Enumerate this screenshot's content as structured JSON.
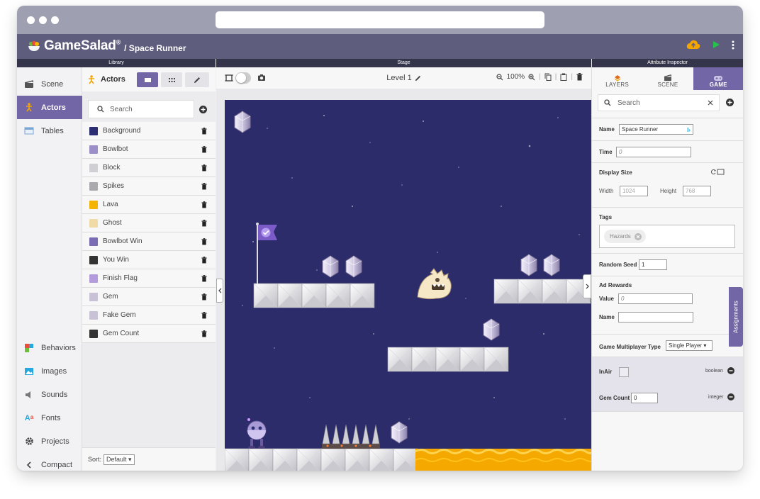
{
  "app": {
    "name": "GameSalad",
    "trademark": "®",
    "project": "/ Space Runner"
  },
  "section_titles": {
    "library": "Library",
    "stage": "Stage",
    "inspector": "Attribute Inspector"
  },
  "sidenav": {
    "top": [
      {
        "name": "scene",
        "label": "Scene",
        "icon": "scene-icon"
      },
      {
        "name": "actors",
        "label": "Actors",
        "icon": "actor-icon",
        "active": true
      },
      {
        "name": "tables",
        "label": "Tables",
        "icon": "table-icon"
      }
    ],
    "bottom": [
      {
        "name": "behaviors",
        "label": "Behaviors",
        "icon": "behaviors-icon"
      },
      {
        "name": "images",
        "label": "Images",
        "icon": "image-icon"
      },
      {
        "name": "sounds",
        "label": "Sounds",
        "icon": "sound-icon"
      },
      {
        "name": "fonts",
        "label": "Fonts",
        "icon": "fonts-icon"
      },
      {
        "name": "projects",
        "label": "Projects",
        "icon": "gear-icon"
      },
      {
        "name": "compact",
        "label": "Compact",
        "icon": "chevron-left-icon"
      }
    ]
  },
  "library": {
    "title": "Actors",
    "search_placeholder": "Search",
    "actors": [
      {
        "label": "Background",
        "color": "#2b2e72"
      },
      {
        "label": "Bowlbot",
        "color": "#9c8ec8"
      },
      {
        "label": "Block",
        "color": "#cfcfd4"
      },
      {
        "label": "Spikes",
        "color": "#a9a9ae"
      },
      {
        "label": "Lava",
        "color": "#f5b400"
      },
      {
        "label": "Ghost",
        "color": "#f0dba6"
      },
      {
        "label": "Bowlbot Win",
        "color": "#7a6bb4"
      },
      {
        "label": "You Win",
        "color": "#333333"
      },
      {
        "label": "Finish Flag",
        "color": "#b49bdc"
      },
      {
        "label": "Gem",
        "color": "#c9c2d6"
      },
      {
        "label": "Fake Gem",
        "color": "#c9c2d6"
      },
      {
        "label": "Gem Count",
        "color": "#333333"
      }
    ],
    "sort_label": "Sort:",
    "sort_value": "Default"
  },
  "stage": {
    "level": "Level 1",
    "zoom": "100%"
  },
  "inspector": {
    "tabs": [
      {
        "label": "LAYERS",
        "icon": "layers-icon"
      },
      {
        "label": "SCENE",
        "icon": "scene-icon"
      },
      {
        "label": "GAME",
        "icon": "gamepad-icon",
        "active": true
      }
    ],
    "search_placeholder": "Search",
    "name_label": "Name",
    "name_value": "Space Runner",
    "time_label": "Time",
    "time_placeholder": "0",
    "display_size_label": "Display Size",
    "width_label": "Width",
    "width_placeholder": "1024",
    "height_label": "Height",
    "height_placeholder": "768",
    "tags_label": "Tags",
    "tag": "Hazards",
    "random_seed_label": "Random Seed",
    "random_seed_value": "1",
    "ad_rewards_label": "Ad Rewards",
    "value_label": "Value",
    "value_placeholder": "0",
    "ad_name_label": "Name",
    "multiplayer_label": "Game Multiplayer Type",
    "multiplayer_value": "Single Player",
    "inair_label": "InAir",
    "inair_type": "boolean",
    "gemcount_label": "Gem Count",
    "gemcount_value": "0",
    "gemcount_type": "integer",
    "assignments_label": "Assignments"
  },
  "colors": {
    "accent": "#7366a6",
    "appbar": "#5e5d7e",
    "chrome": "#9e9fb0",
    "space": "#2d2c6a",
    "lava": "#f5a800",
    "upload": "#f5a500",
    "play": "#27c24c"
  }
}
